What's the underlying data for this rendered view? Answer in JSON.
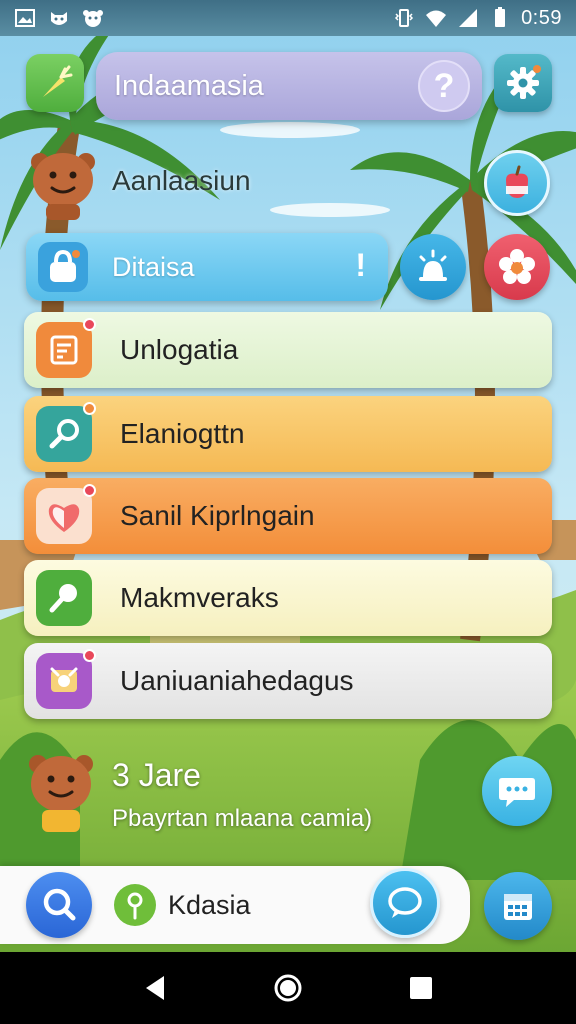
{
  "status_bar": {
    "time": "0:59",
    "left_icons": [
      "gallery-icon",
      "cat-face-icon",
      "dog-face-icon"
    ],
    "right_icons": [
      "vibrate-icon",
      "wifi-icon",
      "signal-icon",
      "battery-icon"
    ]
  },
  "header": {
    "search_text": "Indaamasia",
    "help_label": "?",
    "menu_icon": "carrot-icon",
    "settings_icon": "gear-icon"
  },
  "greeting": {
    "text": "Aanlaasiun",
    "action_icon": "apple-icon"
  },
  "banner": {
    "label": "Ditaisa",
    "badge": "!",
    "icon": "bag-icon",
    "side_icons": [
      "alarm-light-icon",
      "flower-icon"
    ]
  },
  "list": {
    "items": [
      {
        "label": "Unlogatia",
        "icon": "note-icon",
        "color": "#e6f4d6"
      },
      {
        "label": "Elaniogttn",
        "icon": "magnifier-icon",
        "color": "#f8c66a"
      },
      {
        "label": "Sanil Kiprlngain",
        "icon": "heart-icon",
        "color": "#f7a04b"
      },
      {
        "label": "Makmveraks",
        "icon": "paddle-icon",
        "color": "#fbf7cf"
      },
      {
        "label": "Uaniuaniahedagus",
        "icon": "photo-icon",
        "color": "#ececec"
      }
    ]
  },
  "footer_info": {
    "count": "3 Jare",
    "subtitle": "Pbayrtan mlaana camia)",
    "chat_icon": "speech-bubble-icon"
  },
  "bottom_bar": {
    "search_icon": "search-icon",
    "center_label": "Kdasia",
    "center_icon": "location-pin-icon",
    "chat_icon": "chat-bubble-icon",
    "calendar_icon": "calendar-icon"
  },
  "colors": {
    "accent_blue": "#3aa2dd",
    "accent_purple": "#aaa6da",
    "accent_red": "#e9485a"
  }
}
